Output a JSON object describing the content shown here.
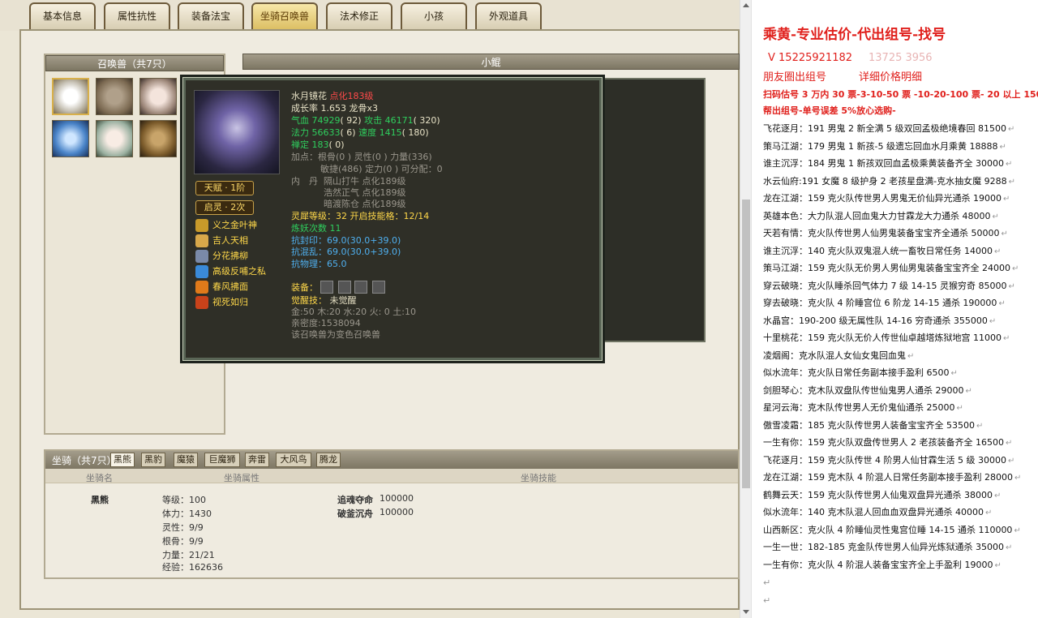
{
  "tabs": [
    {
      "label": "基本信息",
      "active": false
    },
    {
      "label": "属性抗性",
      "active": false
    },
    {
      "label": "装备法宝",
      "active": false
    },
    {
      "label": "坐骑召唤兽",
      "active": true
    },
    {
      "label": "法术修正",
      "active": false
    },
    {
      "label": "小孩",
      "active": false
    },
    {
      "label": "外观道具",
      "active": false
    }
  ],
  "pet_list": {
    "title": "召唤兽（共7只）"
  },
  "pet_detail": {
    "title": "小鲲"
  },
  "tooltip": {
    "name": "水月镜花",
    "level_text": "点化183级",
    "growth": "成长率 1.653 龙骨x3",
    "hp_label": "气血",
    "hp_value": "74929",
    "hp_extra": "( 92)",
    "atk_label": "攻击",
    "atk_value": "46171",
    "atk_extra": "( 320)",
    "mp_label": "法力",
    "mp_value": "56633",
    "mp_extra": "( 6)",
    "spd_label": "速度",
    "spd_value": "1415",
    "spd_extra": "( 180)",
    "zen_label": "禅定",
    "zen_value": "183",
    "zen_extra": "( 0)",
    "points_line1": "加点：根骨(0 ) 灵性(0 ) 力量(336)",
    "points_line2": "敏捷(486) 定力(0 ) 可分配：0",
    "neidan_label": "内　丹",
    "neidan_line1": "隔山打牛 点化189级",
    "neidan_line2": "浩然正气 点化189级",
    "neidan_line3": "暗渡陈仓 点化189级",
    "lingxi": "灵犀等级：32 开启技能格：12/14",
    "lianyao": "炼妖次数 11",
    "res1": "抗封印：69.0(30.0+39.0)",
    "res2": "抗混乱：69.0(30.0+39.0)",
    "res3": "抗物理：65.0",
    "equip_label": "装备：",
    "awaken_label": "觉醒技：",
    "awaken_value": "未觉醒",
    "elements": "金:50 木:20 水:20 火: 0 土:10",
    "intimacy": "亲密度:1538094",
    "note": "该召唤兽为变色召唤兽",
    "talent": "天赋 · 1阶",
    "qiling": "启灵 · 2次",
    "skills": [
      "义之金叶神",
      "吉人天相",
      "分花拂柳",
      "高级反哺之私",
      "春风拂面",
      "视死如归"
    ]
  },
  "mount": {
    "title": "坐骑（共7只）",
    "tabs": [
      "黑熊",
      "黑豹",
      "魔猿",
      "巨魔狮",
      "奔雷",
      "大风鸟",
      "腾龙"
    ],
    "col_name": "坐骑名",
    "col_attr": "坐骑属性",
    "col_skill": "坐骑技能",
    "name": "黑熊",
    "stats": [
      "等级：100",
      "体力：1430",
      "灵性：9/9",
      "根骨：9/9",
      "力量：21/21",
      "经验：162636"
    ],
    "skills": [
      {
        "name": "追魂夺命",
        "value": "100000"
      },
      {
        "name": "破釜沉舟",
        "value": "100000"
      }
    ]
  },
  "doc": {
    "title": "乘黄-专业估价-代出组号-找号",
    "phone": "V 15225921182",
    "phone_blur": "13725   3956",
    "line2_a": "朋友圈出组号",
    "line2_b": "详细价格明细",
    "price_line": "扫码估号 3 万内 30 票-3-10-50 票 -10-20-100 票- 20 以上 150",
    "help_line": "帮出组号-单号误差 5%放心选购-",
    "listings": [
      "飞花逐月：191 男鬼 2 新全满 5 级双回孟极绝境春回 81500",
      "策马江湖：179 男鬼 1 新孩-5 级遗忘回血水月乘黄 18888",
      "谁主沉浮：184 男鬼 1 新孩双回血孟极乘黄装备齐全 30000",
      "水云仙府:191 女魔 8 级护身 2 老孩星盘满-克水抽女魔 9288",
      "龙在江湖：159 克火队传世男人男鬼无价仙异光通杀 19000",
      "英雄本色：大力队混人回血鬼大力甘霖龙大力通杀 48000",
      "天若有情：克火队传世男人仙男鬼装备宝宝齐全通杀 50000",
      "谁主沉浮：140 克火队双鬼混人统一畜牧日常任务 14000",
      "策马江湖：159 克火队无价男人男仙男鬼装备宝宝齐全 24000",
      "穿云破晓：克火队睡杀回气体力 7 级 14-15 灵猴穷奇 85000",
      "穿去破晓：克火队 4 阶睡宫位 6 阶龙 14-15 通杀 190000",
      "水晶宫：190-200 级无属性队 14-16 穷奇通杀 355000",
      "十里桃花：159 克火队无价人传世仙卓越塔炼狱地宫 11000",
      "凌烟阁：克水队混人女仙女鬼回血鬼",
      "似水流年：克火队日常任务副本接手盈利 6500",
      "剑胆琴心：克木队双盘队传世仙鬼男人通杀 29000",
      "星河云海：克木队传世男人无价鬼仙通杀 25000",
      "傲雪凌霜：185 克火队传世男人装备宝宝齐全 53500",
      "一生有你：159 克火队双盘传世男人 2 老孩装备齐全 16500",
      "飞花逐月：159 克火队传世 4 阶男人仙甘霖生活 5 级 30000",
      "龙在江湖：159 克木队 4 阶混人日常任务副本接手盈利 28000",
      "鹤舞云天：159 克火队传世男人仙鬼双盘异光通杀 38000",
      "似水流年：140 克木队混人回血血双盘异光通杀 40000",
      "山西新区：克火队 4 阶睡仙灵性鬼宫位睡 14-15 通杀 110000",
      "一生一世：182-185 克金队传世男人仙异光炼狱通杀 35000",
      "一生有你：克火队 4 阶混人装备宝宝齐全上手盈利 19000"
    ],
    "colors": {
      "title": "#e0201c",
      "price": "#e0201c",
      "help": "#e0201c"
    }
  }
}
